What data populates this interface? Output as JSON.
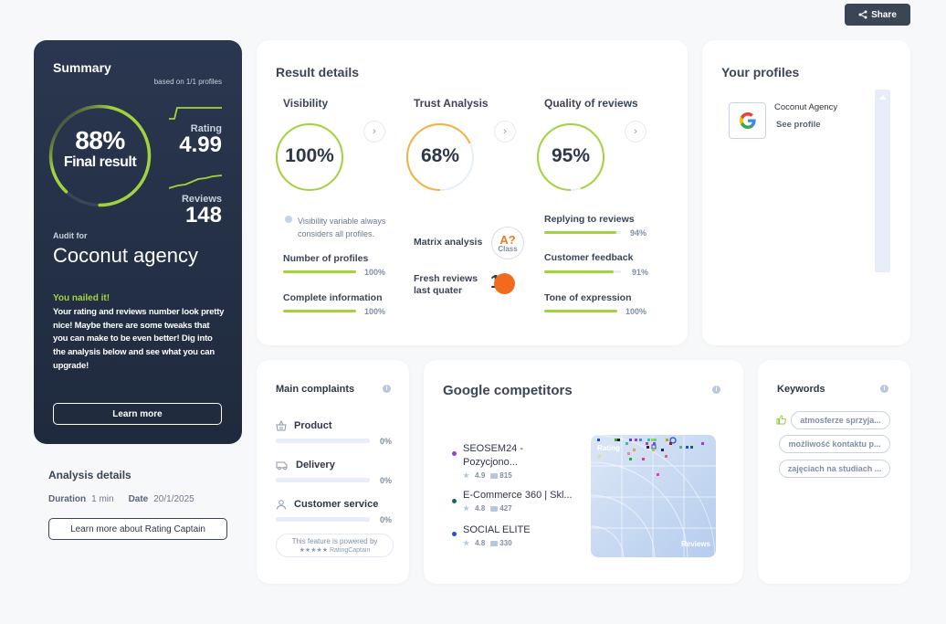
{
  "header": {
    "share_label": "Share"
  },
  "summary": {
    "title": "Summary",
    "based_on": "based on 1/1 profiles",
    "final_percent": 88,
    "final_percent_text": "88%",
    "final_label": "Final result",
    "rating_label": "Rating",
    "rating_value": "4.99",
    "reviews_label": "Reviews",
    "reviews_value": "148",
    "audit_for_label": "Audit for",
    "audit_name": "Coconut agency",
    "nailed_title": "You nailed it!",
    "nailed_text": "Your rating and reviews number look pretty nice! Maybe there are some tweaks that you can make to be even better! Dig into the analysis below and see what you can upgrade!",
    "learn_more_label": "Learn more",
    "accent_color": "#a3d33c"
  },
  "analysis_details": {
    "title": "Analysis details",
    "duration_label": "Duration",
    "duration_value": "1 min",
    "date_label": "Date",
    "date_value": "20/1/2025",
    "button_label": "Learn more about Rating Captain"
  },
  "result_details": {
    "title": "Result details",
    "visibility": {
      "title": "Visibility",
      "percent": 100,
      "percent_text": "100%",
      "color": "#a3d33c",
      "note": "Visibility variable always considers all profiles.",
      "metrics": [
        {
          "label": "Number of profiles",
          "percent": 100,
          "percent_text": "100%"
        },
        {
          "label": "Complete information",
          "percent": 100,
          "percent_text": "100%"
        }
      ]
    },
    "trust": {
      "title": "Trust Analysis",
      "percent": 68,
      "percent_text": "68%",
      "color": "#f5b13d",
      "matrix_label": "Matrix analysis",
      "class_value": "A?",
      "class_label": "Class",
      "fresh_label": "Fresh reviews last quater",
      "fresh_value": "1"
    },
    "quality": {
      "title": "Quality of reviews",
      "percent": 95,
      "percent_text": "95%",
      "color": "#a3d33c",
      "metrics": [
        {
          "label": "Replying to reviews",
          "percent": 94,
          "percent_text": "94%"
        },
        {
          "label": "Customer feedback",
          "percent": 91,
          "percent_text": "91%"
        },
        {
          "label": "Tone of expression",
          "percent": 100,
          "percent_text": "100%"
        }
      ]
    }
  },
  "profiles": {
    "title": "Your profiles",
    "items": [
      {
        "name": "Coconut Agency",
        "link": "See profile",
        "platform": "google-icon"
      }
    ]
  },
  "complaints": {
    "title": "Main complaints",
    "items": [
      {
        "label": "Product",
        "icon": "basket-icon",
        "percent": 0,
        "percent_text": "0%"
      },
      {
        "label": "Delivery",
        "icon": "truck-icon",
        "percent": 0,
        "percent_text": "0%"
      },
      {
        "label": "Customer service",
        "icon": "person-icon",
        "percent": 0,
        "percent_text": "0%"
      }
    ],
    "powered_by": "This feature is powered by",
    "powered_brand": "★★★★★ RatingCaptain"
  },
  "competitors": {
    "title": "Google competitors",
    "items": [
      {
        "name": "SEOSEM24 - Pozycjono...",
        "rating": "4.9",
        "reviews": "815",
        "color": "#9b3fcf"
      },
      {
        "name": "E-Commerce 360 | Skl...",
        "rating": "4.8",
        "reviews": "427",
        "color": "#0f6b6b"
      },
      {
        "name": "SOCIAL ELITE",
        "rating": "4.8",
        "reviews": "330",
        "color": "#1f4fd6"
      }
    ],
    "matrix": {
      "rating_label": "Rating",
      "reviews_label": "Reviews"
    }
  },
  "keywords": {
    "title": "Keywords",
    "items": [
      {
        "label": "atmosferze sprzyja...",
        "positive": true
      },
      {
        "label": "możliwość kontaktu p...",
        "positive": false
      },
      {
        "label": "zajęciach na studiach ...",
        "positive": false
      }
    ]
  }
}
